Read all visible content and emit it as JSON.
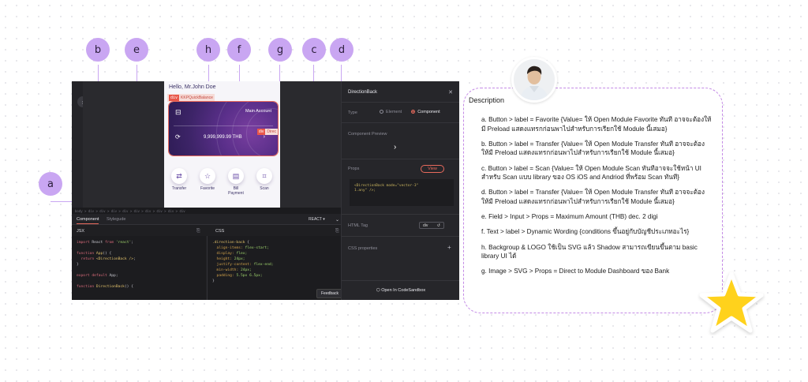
{
  "callouts": [
    "a",
    "b",
    "c",
    "d",
    "e",
    "f",
    "g",
    "h"
  ],
  "phone": {
    "greeting": "Hello, Mr.John Doe",
    "component_tag_div": "div",
    "component_tag_name": "KKPQuickBalance",
    "account_label": "Main Account",
    "amount": "9,999,999.99 THB",
    "amount_tag_div": "div",
    "amount_tag_name": "Direc",
    "actions": [
      {
        "label": "Transfer",
        "icon": "transfer-icon"
      },
      {
        "label": "Favorite",
        "icon": "star-icon"
      },
      {
        "label": "Bill\nPayment",
        "icon": "bill-icon"
      },
      {
        "label": "Scan",
        "icon": "scan-icon"
      }
    ]
  },
  "breadcrumb": "body > div > div > div > div > div > div > div > div > div",
  "editor": {
    "tabs": [
      "Component",
      "Stylegude"
    ],
    "framework": "REACT",
    "jsx_header": "JSX",
    "css_header": "CSS",
    "feedback": "Feedback"
  },
  "props_panel": {
    "title": "DirectionBack",
    "type_label": "Type",
    "type_options": [
      "Element",
      "Component"
    ],
    "preview_label": "Component Preview",
    "props_label": "Props",
    "view_button": "View",
    "props_code_line1": "<DirectionBack mode=\"vector-3\"",
    "props_code_line2": "1.any\" />;",
    "html_tag_label": "HTML Tag",
    "html_tag_value": "div",
    "css_properties_label": "CSS properties",
    "open_codesandbox": "Open In CodeSandbox"
  },
  "description": {
    "title": "Description",
    "items": [
      "a. Button > label = Favorite {Value= ให้ Open Module Favorite ทันที อาจจะต้องให้มี Preload แสดงแทรกก่อนพาไปสำหรับการเรียกใช้ Module นี้เสมอ}",
      "b. Button > label = Transfer {Value= ให้ Open Module Transfer ทันที อาจจะต้องให้มี Preload แสดงแทรกก่อนพาไปสำหรับการเรียกใช้ Module นี้เสมอ}",
      "c. Button > label = Scan {Value= ให้ Open Module Scan ทันทีอาจจะใช้หน้า UI สำหรับ Scan แบบ library ของ OS iOS and Andriod ที่พร้อม Scan ทันที}",
      "d. Button > label = Transfer {Value= ให้ Open Module Transfer ทันที อาจจะต้องให้มี Preload แสดงแทรกก่อนพาไปสำหรับการเรียกใช้ Module นี้เสมอ}",
      "e. Field > Input > Props = Maximum Amount (THB) dec. 2 digi",
      "f. Text > label > Dynamic Wording {conditions ขึ้นอยู่กับบัญชีประเภทอะไร}",
      "h. Backgroup & LOGO ใช้เป็น SVG แล้ว Shadow สามารถเขียนขึ้นตาม basic library UI ได้",
      "g. Image > SVG > Props = Direct to Module Dashboard ของ Bank"
    ]
  }
}
